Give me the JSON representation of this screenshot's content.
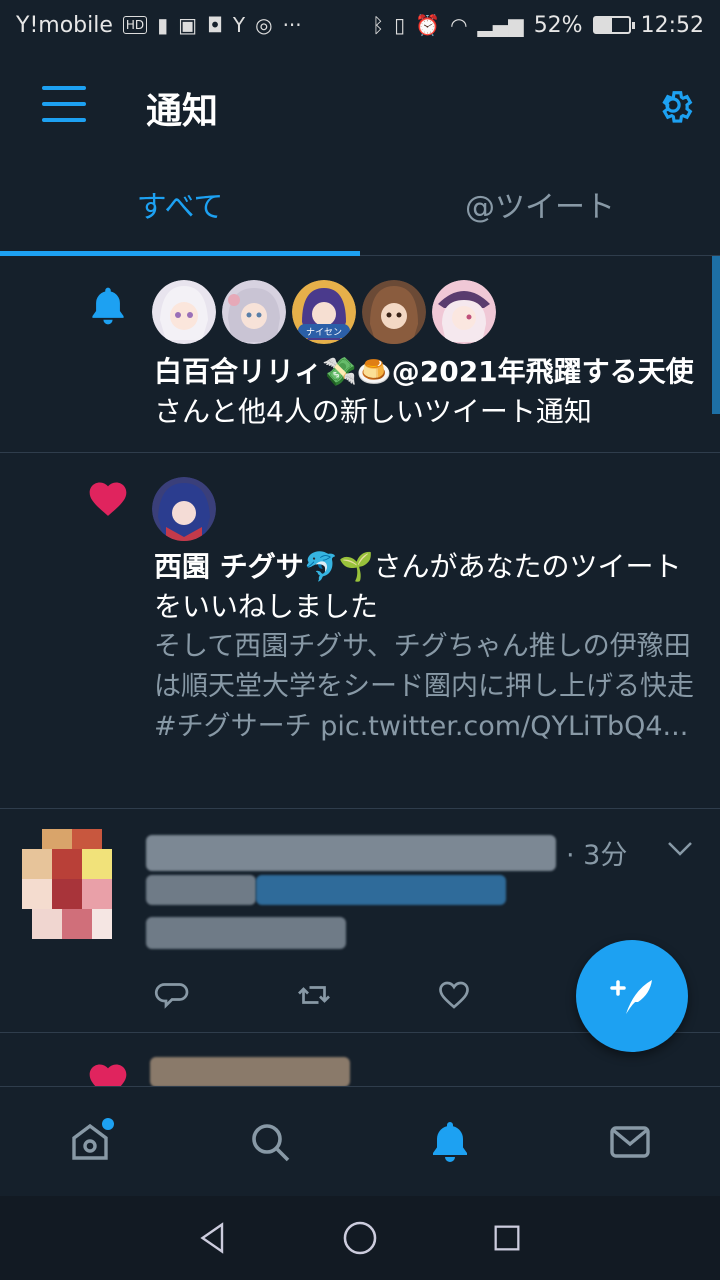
{
  "status_bar": {
    "carrier": "Y!mobile",
    "hd_badge": "HD",
    "battery_text": "52%",
    "battery_level": 0.52,
    "time": "12:52"
  },
  "header": {
    "title": "通知"
  },
  "tabs": [
    {
      "label": "すべて",
      "active": true
    },
    {
      "label": "@ツイート",
      "active": false
    }
  ],
  "notifications": [
    {
      "type": "bell",
      "avatars": [
        "avatar-1",
        "avatar-2",
        "avatar-3",
        "avatar-4",
        "avatar-5"
      ],
      "avatar_caption": "ナイセン",
      "name_bold": "白百合リリィ💸🍮@2021年飛躍する天使",
      "suffix": "さんと他4人の新しいツイート通知"
    },
    {
      "type": "like",
      "name_bold": "西園 チグサ🐬🌱",
      "suffix": "さんがあなたのツイートをいいねしました",
      "tweet_text": "そして西園チグサ、チグちゃん推しの伊豫田は順天堂大学をシード圏内に押し上げる快走",
      "tweet_link": "#チグサーチ pic.twitter.com/QYLiTbQ4..."
    },
    {
      "type": "tweet",
      "time_meta": "· 3分"
    }
  ],
  "colors": {
    "background": "#15202b",
    "accent": "#1da1f2",
    "like": "#e0245e",
    "muted": "#8899a6"
  },
  "icons": {
    "menu": "hamburger-icon",
    "settings": "gear-icon",
    "compose": "feather-plus-icon",
    "nav": [
      "home-icon",
      "search-icon",
      "bell-icon",
      "mail-icon"
    ],
    "system": [
      "back-icon",
      "home-circle-icon",
      "recents-icon"
    ]
  }
}
